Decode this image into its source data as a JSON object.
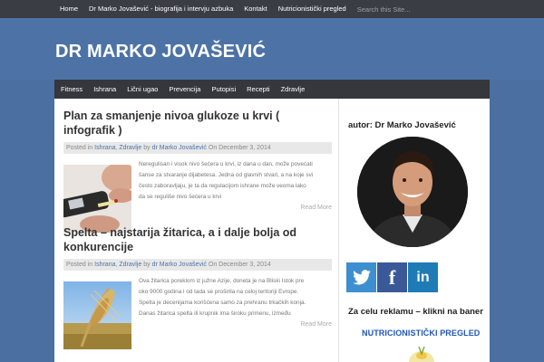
{
  "topnav": {
    "items": [
      {
        "label": "Home"
      },
      {
        "label": "Dr Marko Jovašević - biografija i intervju azbuka"
      },
      {
        "label": "Kontakt"
      },
      {
        "label": "Nutricionistički pregled"
      }
    ],
    "search_placeholder": "Search this Site..."
  },
  "header": {
    "title": "DR MARKO JOVAŠEVIĆ"
  },
  "mainnav": {
    "items": [
      {
        "label": "Fitness"
      },
      {
        "label": "Ishrana"
      },
      {
        "label": "Lični ugao"
      },
      {
        "label": "Prevencija"
      },
      {
        "label": "Putopisi"
      },
      {
        "label": "Recepti"
      },
      {
        "label": "Zdravlje"
      }
    ]
  },
  "posts": [
    {
      "title": "Plan za smanjenje nivoa glukoze u krvi ( infografik )",
      "meta": {
        "posted_in": "Posted in",
        "cat1": "Ishrana",
        "sep": ",",
        "cat2": "Zdravlje",
        "by": "by",
        "author": "dr Marko Jovašević",
        "on": "On December 3, 2014"
      },
      "excerpt": [
        "Neregulisan i visok nivo šećera u krvi, iz dana u dan, može povećati",
        "šanse za stvaranje dijabetesa. Jedna od glavnih stvari, a na koje svi",
        "često zaboravljaju, je ta da regulacijom ishrane može veoma lako",
        "da se reguliše nivo šećera u krvi"
      ],
      "more": "Read More"
    },
    {
      "title_line1": "Spelta – najstarija žitarica, a i dalje bolja od",
      "title_line2": "konkurencije",
      "meta": {
        "posted_in": "Posted in",
        "cat1": "Ishrana",
        "sep": ",",
        "cat2": "Zdravlje",
        "by": "by",
        "author": "dr Marko Jovašević",
        "on": "On December 3, 2014"
      },
      "excerpt": [
        "Ova žitarica poreklom iz južne Azije, doneta je na Bliski Istok pre",
        "oko 9000 godina i od tada se proširila na celoj teritoriji Evrope.",
        "Spelta je decenijama korišćena samo za prehranu trkačkih konja.",
        "Danas žitarica spelta ili krupnik ima široku primenu, između"
      ],
      "more": "Read More"
    }
  ],
  "sidebar": {
    "author_title": "autor: Dr Marko Jovašević",
    "ads_title": "Za celu reklamu – klikni na baner",
    "banner_text": "NUTRICIONISTIČKI PREGLED"
  },
  "colors": {
    "twitter": "#3d8fd0",
    "facebook": "#3b5998",
    "linkedin": "#1e7bb6",
    "header": "#4d73a6"
  }
}
